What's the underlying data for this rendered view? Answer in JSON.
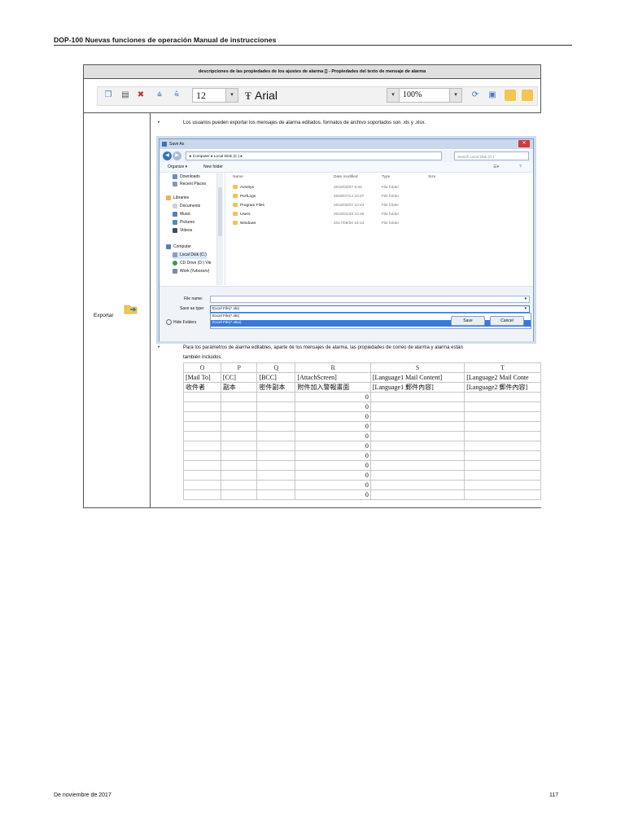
{
  "header": {
    "title": "DOP-100 Nuevas funciones de operación Manual de instrucciones"
  },
  "footer": {
    "date": "De noviembre de 2017",
    "page": "117"
  },
  "section": {
    "caption": "descripciones de las propiedades de los ajustes de alarma [] - Propiedades del texto de mensaje de alarma",
    "toolbar": {
      "font_size": "12",
      "font_name": "Arial",
      "zoom": "100%"
    },
    "row_label": "Exportar",
    "bullet1": "Los usuarios pueden exportar los mensajes de alarma editados. formatos de archivo soportados son .xls y .xlsx.",
    "bullet2_line1": "Para los parámetros de alarma editables, aparte de los mensajes de alarma, las propiedades de correo de alarma y alarma están",
    "bullet2_line2": "también incluidos.",
    "bullet_mark": "•"
  },
  "dialog": {
    "title": "Save As",
    "breadcrumb": "▸ Computer ▸ Local Disk (C:) ▸",
    "search_placeholder": "Search Local Disk (C:)",
    "organize": "Organize ▾",
    "new_folder": "New folder",
    "nav_items": [
      "Downloads",
      "Recent Places",
      "Libraries",
      "Documents",
      "Music",
      "Pictures",
      "Videos",
      "Computer",
      "Local Disk (C:)",
      "CD Drive (D:) Vie",
      "Work (\\\\vboxsrv)"
    ],
    "columns": {
      "name": "Name",
      "date": "Date modified",
      "type": "Type",
      "size": "Size"
    },
    "files": [
      {
        "name": "AvisSys",
        "date": "2016/03/07 9:33",
        "type": "File folder"
      },
      {
        "name": "PerfLogs",
        "date": "2009/07/14 10:27",
        "type": "File folder"
      },
      {
        "name": "Program Files",
        "date": "2016/03/07 10:43",
        "type": "File folder"
      },
      {
        "name": "Users",
        "date": "2016/01/28 10:46",
        "type": "File folder"
      },
      {
        "name": "Windows",
        "date": "2017/09/20 15:14",
        "type": "File folder"
      }
    ],
    "file_name_label": "File name:",
    "save_type_label": "Save as type:",
    "save_type_value": "Excel File(*.xls)",
    "type_options": [
      "Excel File(*.xls)",
      "Excel File(*.xlsx)"
    ],
    "hide_folders": "Hide Folders",
    "save": "Save",
    "cancel": "Cancel"
  },
  "sheet": {
    "columns": [
      "O",
      "P",
      "Q",
      "R",
      "S",
      "T"
    ],
    "rows": [
      [
        "[Mail To]",
        "[CC]",
        "[BCC]",
        "[AttachScreen]",
        "[Language1 Mail Content]",
        "[Language2 Mail Conte"
      ],
      [
        "收件者",
        "副本",
        "密件副本",
        "附件加入警報畫面",
        "[Language1 郵件內容]",
        "[Language2 郵件內容]"
      ],
      [
        "",
        "",
        "",
        "0",
        "",
        ""
      ],
      [
        "",
        "",
        "",
        "0",
        "",
        ""
      ],
      [
        "",
        "",
        "",
        "0",
        "",
        ""
      ],
      [
        "",
        "",
        "",
        "0",
        "",
        ""
      ],
      [
        "",
        "",
        "",
        "0",
        "",
        ""
      ],
      [
        "",
        "",
        "",
        "0",
        "",
        ""
      ],
      [
        "",
        "",
        "",
        "0",
        "",
        ""
      ],
      [
        "",
        "",
        "",
        "0",
        "",
        ""
      ],
      [
        "",
        "",
        "",
        "0",
        "",
        ""
      ],
      [
        "",
        "",
        "",
        "0",
        "",
        ""
      ],
      [
        "",
        "",
        "",
        "0",
        "",
        ""
      ]
    ]
  }
}
